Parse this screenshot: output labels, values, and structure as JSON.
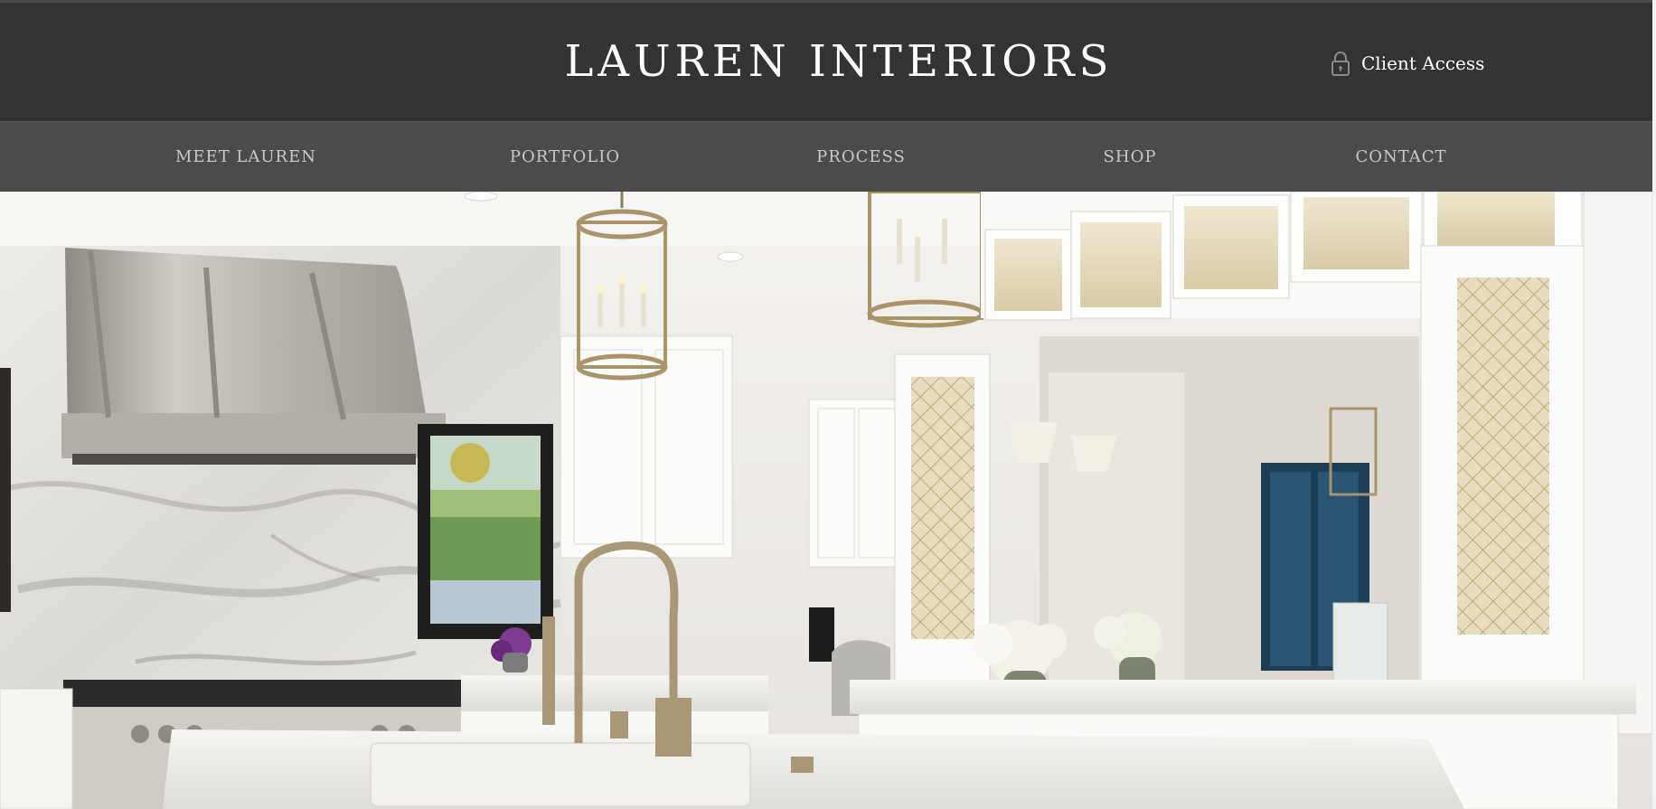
{
  "header": {
    "brand": "LAUREN INTERIORS",
    "client_access": {
      "label": "Client Access",
      "icon": "lock-icon"
    }
  },
  "nav": {
    "items": [
      {
        "label": "MEET LAUREN"
      },
      {
        "label": "PORTFOLIO"
      },
      {
        "label": "PROCESS"
      },
      {
        "label": "SHOP"
      },
      {
        "label": "CONTACT"
      }
    ]
  },
  "colors": {
    "header_bg": "#333333",
    "nav_bg": "#4b4b4b",
    "nav_text": "#c9c9c9",
    "brand_text": "#ffffff"
  },
  "hero": {
    "subject": "white-kitchen-image"
  }
}
